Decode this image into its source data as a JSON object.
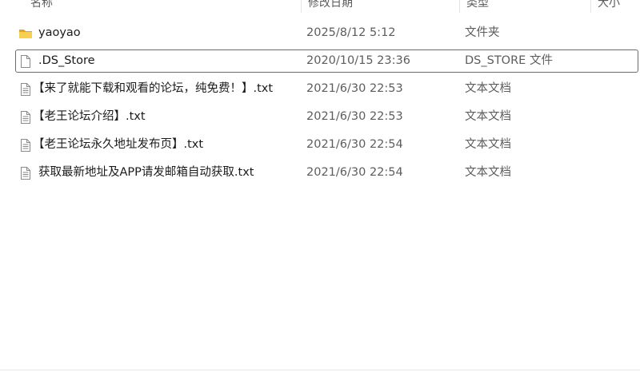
{
  "columns": {
    "name": "名称",
    "date": "修改日期",
    "type": "类型",
    "size": "大小"
  },
  "files": [
    {
      "name": "yaoyao",
      "date": "2025/8/12 5:12",
      "type": "文件夹",
      "icon": "folder-icon"
    },
    {
      "name": ".DS_Store",
      "date": "2020/10/15 23:36",
      "type": "DS_STORE 文件",
      "icon": "blank-file-icon"
    },
    {
      "name": "【来了就能下载和观看的论坛，纯免费！】.txt",
      "date": "2021/6/30 22:53",
      "type": "文本文档",
      "icon": "text-file-icon"
    },
    {
      "name": "【老王论坛介绍】.txt",
      "date": "2021/6/30 22:53",
      "type": "文本文档",
      "icon": "text-file-icon"
    },
    {
      "name": "【老王论坛永久地址发布页】.txt",
      "date": "2021/6/30 22:54",
      "type": "文本文档",
      "icon": "text-file-icon"
    },
    {
      "name": "获取最新地址及APP请发邮箱自动获取.txt",
      "date": "2021/6/30 22:54",
      "type": "文本文档",
      "icon": "text-file-icon"
    }
  ],
  "colors": {
    "folder": "#f4c542",
    "focus_border": "#6b6b6b",
    "secondary_text": "#5d5d5d"
  }
}
